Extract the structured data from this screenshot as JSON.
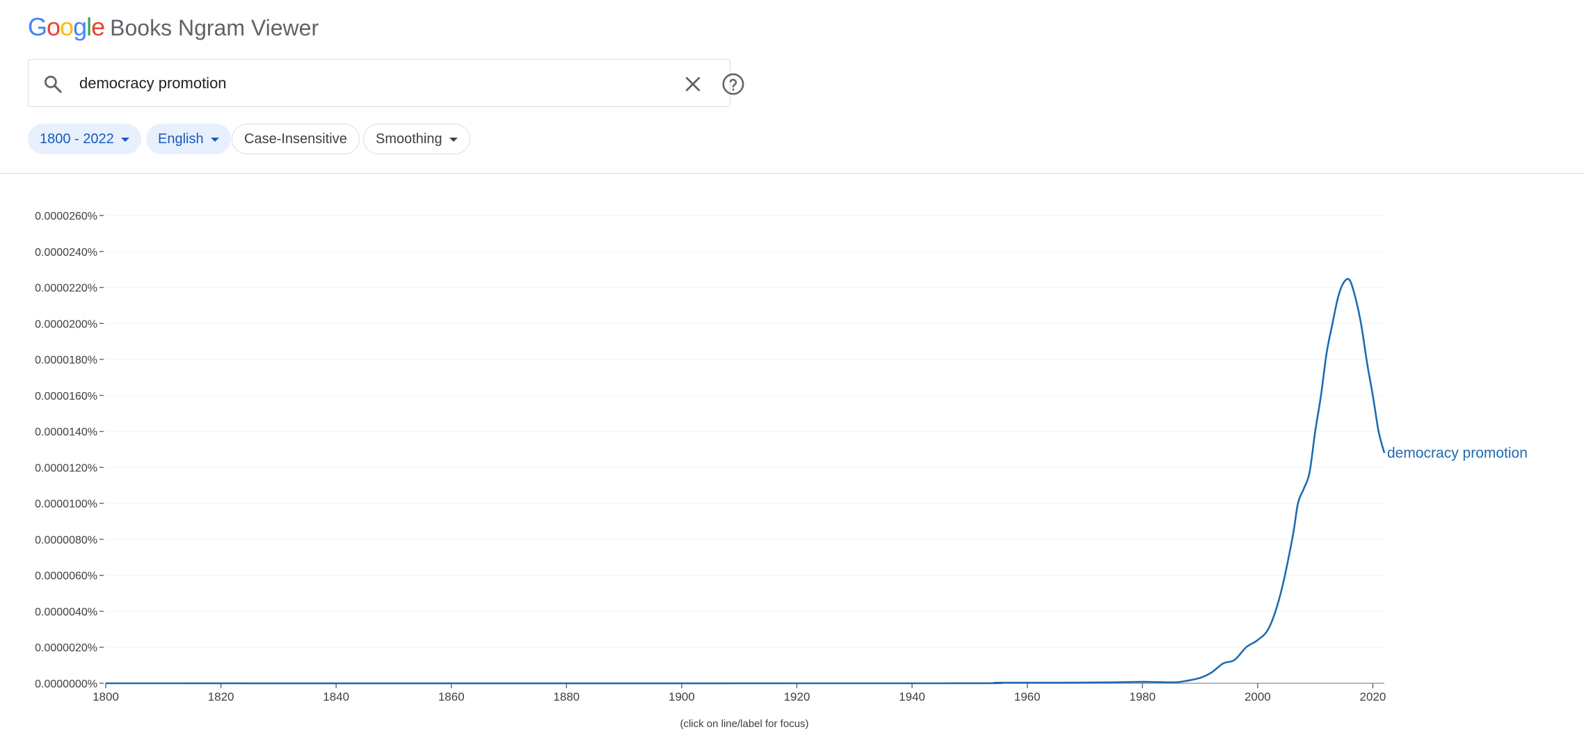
{
  "header": {
    "logo_letters": [
      {
        "char": "G",
        "color": "#4285F4"
      },
      {
        "char": "o",
        "color": "#EA4335"
      },
      {
        "char": "o",
        "color": "#FBBC05"
      },
      {
        "char": "g",
        "color": "#4285F4"
      },
      {
        "char": "l",
        "color": "#34A853"
      },
      {
        "char": "e",
        "color": "#EA4335"
      }
    ],
    "logo_rest": "Books Ngram Viewer",
    "search": {
      "value": "democracy promotion",
      "search_icon": "search-icon",
      "clear_icon": "close-icon",
      "help_icon": "help-icon"
    },
    "chips": {
      "years": "1800 - 2022",
      "corpus": "English",
      "case": "Case-Insensitive",
      "smoothing": "Smoothing"
    }
  },
  "chart_data": {
    "type": "line",
    "title": "",
    "xlabel": "",
    "ylabel": "",
    "xlim": [
      1800,
      2022
    ],
    "ylim": [
      0,
      2.6e-05
    ],
    "x_ticks": [
      1800,
      1820,
      1840,
      1860,
      1880,
      1900,
      1920,
      1940,
      1960,
      1980,
      2000,
      2020
    ],
    "x_tick_labels": [
      "1800",
      "1820",
      "1840",
      "1860",
      "1880",
      "1900",
      "1920",
      "1940",
      "1960",
      "1980",
      "2000",
      "2020"
    ],
    "y_ticks": [
      0,
      2e-06,
      4e-06,
      6e-06,
      8e-06,
      1e-05,
      1.2e-05,
      1.4e-05,
      1.6e-05,
      1.8e-05,
      2e-05,
      2.2e-05,
      2.4e-05,
      2.6e-05
    ],
    "y_tick_labels": [
      "0.0000000%",
      "0.0000020%",
      "0.0000040%",
      "0.0000060%",
      "0.0000080%",
      "0.0000100%",
      "0.0000120%",
      "0.0000140%",
      "0.0000160%",
      "0.0000180%",
      "0.0000200%",
      "0.0000220%",
      "0.0000240%",
      "0.0000260%"
    ],
    "grid": true,
    "legend": "inline-right",
    "series": [
      {
        "name": "democracy promotion",
        "color": "#1f6bb0",
        "x": [
          1800,
          1940,
          1955,
          1965,
          1975,
          1980,
          1985,
          1987,
          1990,
          1992,
          1994,
          1996,
          1998,
          2000,
          2002,
          2004,
          2006,
          2007,
          2008,
          2009,
          2010,
          2011,
          2012,
          2013,
          2014,
          2015,
          2016,
          2017,
          2018,
          2019,
          2020,
          2021,
          2022
        ],
        "values": [
          0,
          0,
          3e-08,
          3e-08,
          5e-08,
          8e-08,
          5e-08,
          1e-07,
          3e-07,
          6e-07,
          1.1e-06,
          1.3e-06,
          2e-06,
          2.4e-06,
          3.1e-06,
          5e-06,
          8e-06,
          1e-05,
          1.08e-05,
          1.17e-05,
          1.4e-05,
          1.6e-05,
          1.84e-05,
          2e-05,
          2.15e-05,
          2.23e-05,
          2.24e-05,
          2.14e-05,
          1.99e-05,
          1.78e-05,
          1.6e-05,
          1.4e-05,
          1.28e-05
        ]
      }
    ],
    "hint": "(click on line/label for focus)"
  }
}
